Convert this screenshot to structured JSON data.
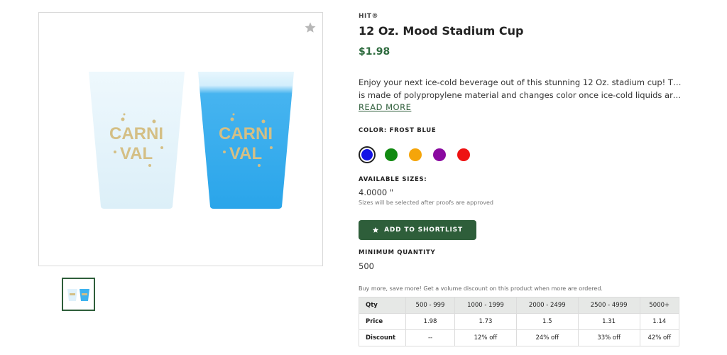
{
  "product": {
    "brand": "HIT®",
    "title": "12 Oz. Mood Stadium Cup",
    "price": "$1.98",
    "description_lines": [
      "Enjoy your next ice-cold beverage out of this stunning 12 Oz. stadium cup! This item",
      "is made of polypropylene material and changes color once ice-cold liquids are adde..."
    ],
    "read_more": "READ MORE",
    "cup_text_line1": "CARNI",
    "cup_text_line2": "VAL"
  },
  "color": {
    "label": "COLOR: FROST BLUE",
    "swatches": [
      "#1414e6",
      "#118a11",
      "#f5a50a",
      "#8a0aa0",
      "#ee1212"
    ],
    "selected_index": 0
  },
  "sizes": {
    "label": "AVAILABLE SIZES:",
    "value": "4.0000 \"",
    "note": "Sizes will be selected after proofs are approved"
  },
  "actions": {
    "shortlist": "ADD TO SHORTLIST"
  },
  "minimum": {
    "label": "MINIMUM QUANTITY",
    "value": "500"
  },
  "pricing": {
    "note": "Buy more, save more! Get a volume discount on this product when more are ordered.",
    "headers": [
      "Qty",
      "500 - 999",
      "1000 - 1999",
      "2000 - 2499",
      "2500 - 4999",
      "5000+"
    ],
    "price_row": [
      "Price",
      "1.98",
      "1.73",
      "1.5",
      "1.31",
      "1.14"
    ],
    "discount_row": [
      "Discount",
      "--",
      "12% off",
      "24% off",
      "33% off",
      "42% off"
    ]
  },
  "colors": {
    "accent": "#2e5e3a",
    "price": "#2e6b3e",
    "cup_frost": "#e3f3fb",
    "cup_blue": "#3eb2ee",
    "cup_text": "#d4bf85"
  }
}
